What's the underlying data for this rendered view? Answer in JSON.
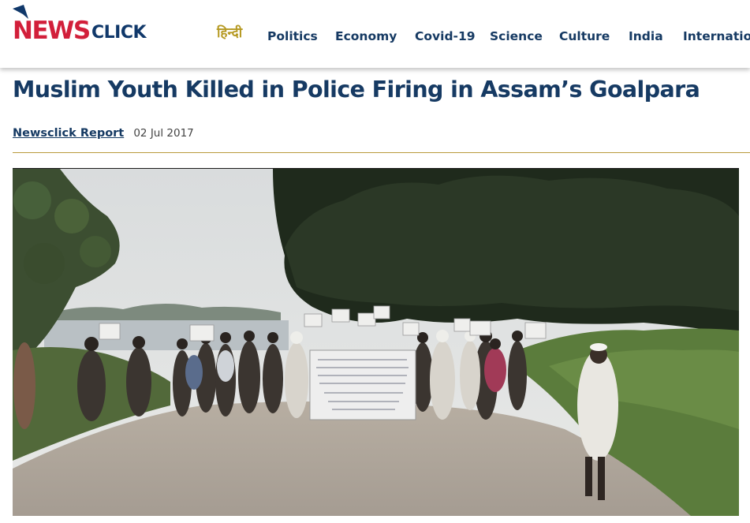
{
  "brand": {
    "logo_text_1": "NEWS",
    "logo_text_2": "CLICK"
  },
  "nav": {
    "items": [
      {
        "label": "हिन्दी"
      },
      {
        "label": "Politics"
      },
      {
        "label": "Economy"
      },
      {
        "label": "Covid-19"
      },
      {
        "label": "Science"
      },
      {
        "label": "Culture"
      },
      {
        "label": "India"
      },
      {
        "label": "International"
      }
    ]
  },
  "article": {
    "title": "Muslim Youth Killed in Police Firing in Assam’s Goalpara",
    "author": "Newsclick Report",
    "date": "02 Jul 2017"
  },
  "colors": {
    "brand_red": "#d21f3a",
    "brand_navy": "#163a63",
    "hindi_gold": "#b69a23",
    "rule": "#b99a3c"
  }
}
